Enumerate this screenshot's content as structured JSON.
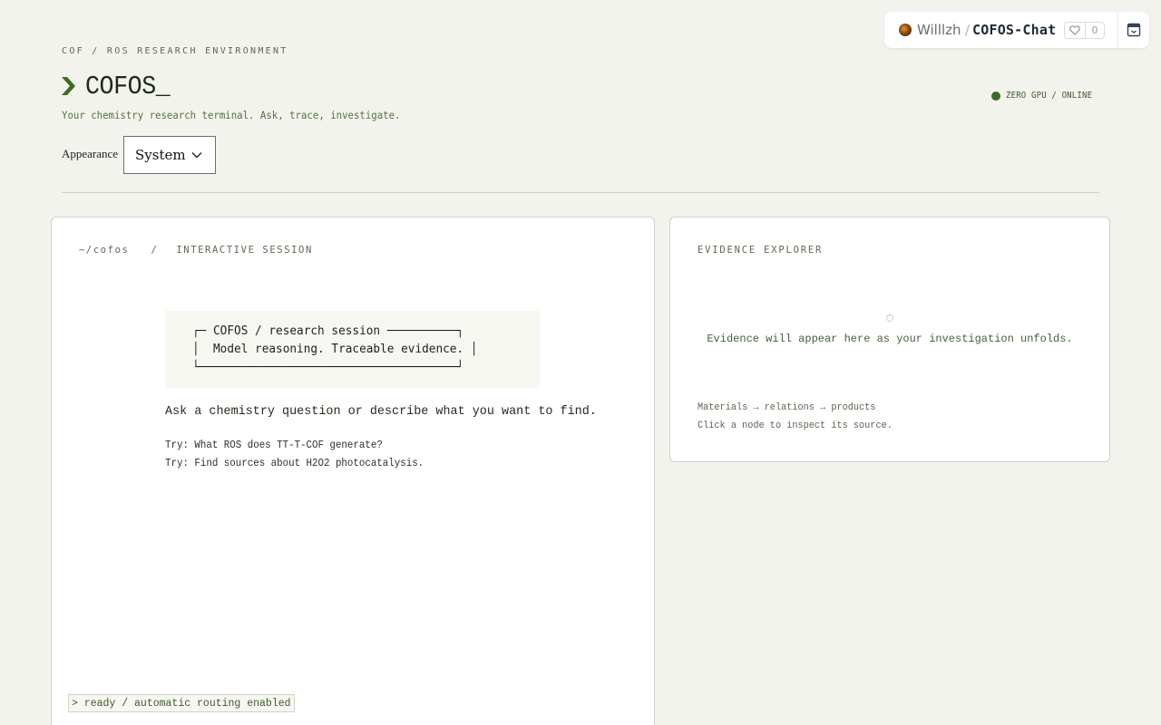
{
  "space": {
    "owner": "Willlzh",
    "separator": "/",
    "repo": "COFOS-Chat",
    "like_count": "0",
    "icons": [
      "avatar",
      "heart-icon",
      "embed-icon"
    ]
  },
  "header": {
    "eyebrow": "COF / ROS RESEARCH ENVIRONMENT",
    "title": "COFOS_",
    "tagline": "Your chemistry research terminal. Ask, trace, investigate.",
    "status": "ZERO GPU / ONLINE",
    "status_color": "#3e6a26"
  },
  "appearance": {
    "label": "Appearance",
    "selected": "System"
  },
  "session": {
    "path_root": "~/cofos",
    "path_sep": "/",
    "path_name": "INTERACTIVE SESSION",
    "ascii_banner": "┌─ COFOS / research session ──────────┐\n│  Model reasoning. Traceable evidence. │\n└─────────────────────────────────────┘",
    "prompt": "Ask a chemistry question or describe what you want to find.",
    "try_1": "Try: What ROS does TT-T-COF generate?",
    "try_2": "Try: Find sources about H2O2 photocatalysis.",
    "status_line": "> ready / automatic routing enabled"
  },
  "evidence": {
    "title": "EVIDENCE EXPLORER",
    "empty_message": "Evidence will appear here as your investigation unfolds.",
    "legend_line_1": "Materials → relations → products",
    "legend_line_2": "Click a node to inspect its source."
  },
  "colors": {
    "background": "#f3f3ee",
    "accent": "#3e6a26",
    "panel_border": "#cfd2c7"
  }
}
